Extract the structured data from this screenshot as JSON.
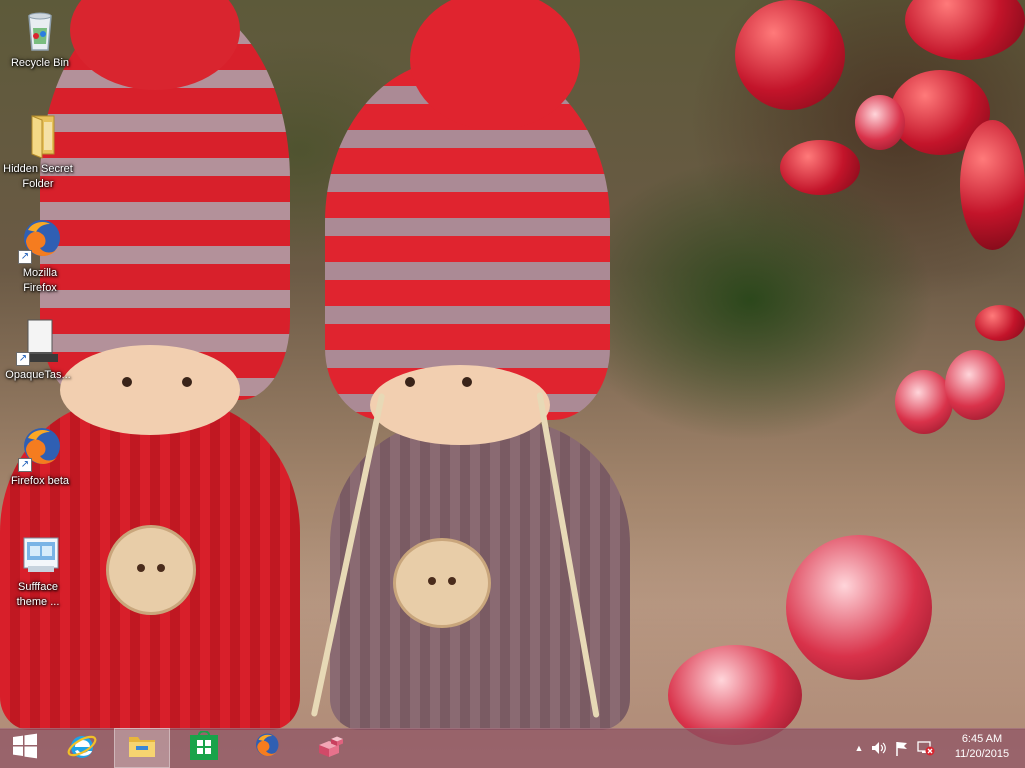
{
  "desktop": {
    "icons": [
      {
        "label": "Recycle Bin",
        "icon": "recycle-bin-icon"
      },
      {
        "label": "Hidden Secret\nFolder",
        "icon": "folder-icon"
      },
      {
        "label": "Mozilla\nFirefox",
        "icon": "firefox-icon"
      },
      {
        "label": "OpaqueTas...",
        "icon": "opaque-taskbar-app-icon"
      },
      {
        "label": "Firefox beta",
        "icon": "firefox-beta-icon"
      },
      {
        "label": "Suffface\ntheme ...",
        "icon": "theme-installer-icon"
      }
    ]
  },
  "taskbar": {
    "pinned": [
      {
        "name": "start",
        "icon": "windows-logo-icon"
      },
      {
        "name": "internet-explorer",
        "icon": "internet-explorer-icon"
      },
      {
        "name": "file-explorer",
        "icon": "file-explorer-icon",
        "active": true
      },
      {
        "name": "store",
        "icon": "windows-store-icon"
      },
      {
        "name": "firefox",
        "icon": "firefox-icon"
      },
      {
        "name": "blocks-app",
        "icon": "blocks-app-icon"
      }
    ],
    "tray": {
      "icons": [
        "chevron-up-icon",
        "speaker-icon",
        "flag-icon",
        "network-disconnected-icon"
      ],
      "time": "6:45 AM",
      "date": "11/20/2015"
    }
  },
  "colors": {
    "taskbar": "#8c505f",
    "accent": "#e0242f"
  }
}
